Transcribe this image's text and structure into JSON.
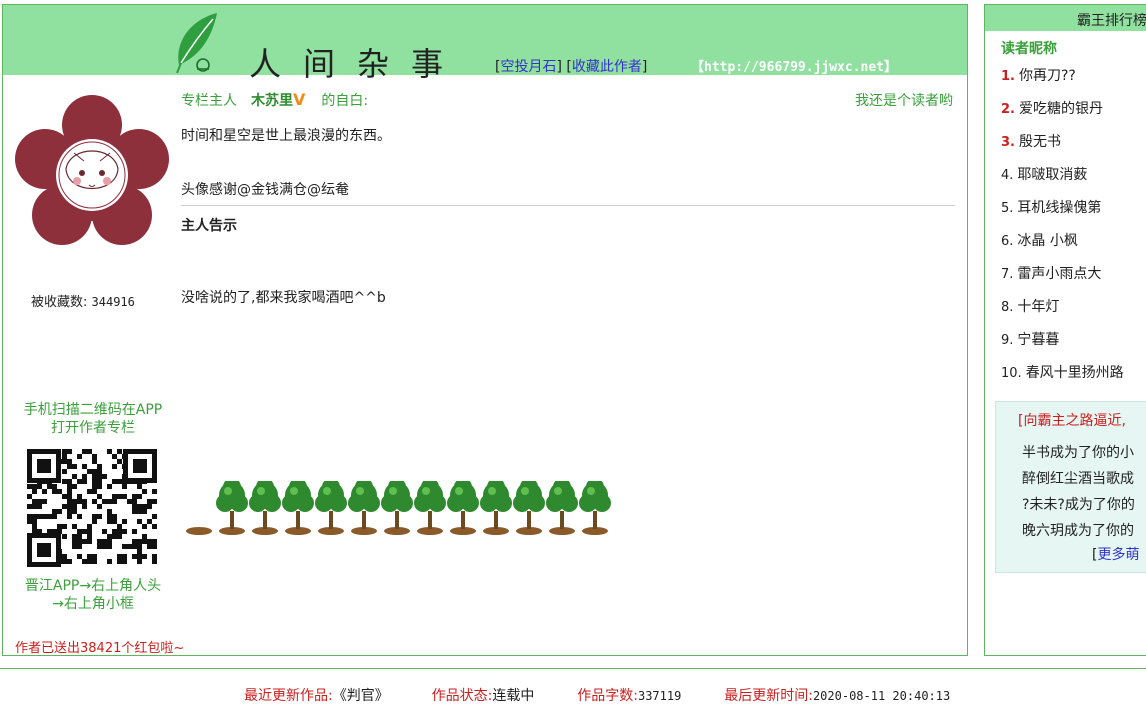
{
  "header": {
    "site_title": "人间杂事",
    "link_bracket_open": "[",
    "link_bracket_mid": "] [",
    "link_bracket_close": "]",
    "link_moonstone": "空投月石",
    "link_favorite": "收藏此作者",
    "url": "【http://966799.jjwxc.net】"
  },
  "profile": {
    "favorites_label": "被收藏数:",
    "favorites_count": "344916",
    "owner_label": "专栏主人",
    "owner_name": "木苏里",
    "v_badge": "V",
    "owner_suffix": "的自白:",
    "reader_link": "我还是个读者哟",
    "bio_line1": "时间和星空是世上最浪漫的东西。",
    "bio_line2": "头像感谢@金钱满仓@纭奙",
    "notice_title": "主人告示",
    "notice_body": "没啥说的了,都来我家喝酒吧^^b"
  },
  "qr": {
    "caption": "手机扫描二维码在APP打开作者专栏",
    "hint": "晋江APP→右上角人头→右上角小框"
  },
  "redpacket": "作者已送出38421个红包啦~",
  "trees": {
    "count": 12,
    "empty_plots": 1
  },
  "sidebar": {
    "title": "霸王排行榜",
    "rank_title": "读者昵称",
    "ranks": [
      {
        "num": "1.",
        "name": "你再刀??"
      },
      {
        "num": "2.",
        "name": "爱吃糖的银丹"
      },
      {
        "num": "3.",
        "name": "殷无书"
      },
      {
        "num": "4.",
        "name": "耶啵取消薮"
      },
      {
        "num": "5.",
        "name": "耳机线操傀第"
      },
      {
        "num": "6.",
        "name": "冰晶 小枫"
      },
      {
        "num": "7.",
        "name": "雷声小雨点大"
      },
      {
        "num": "8.",
        "name": "十年灯"
      },
      {
        "num": "9.",
        "name": "宁暮暮"
      },
      {
        "num": "10.",
        "name": "春风十里扬州路"
      }
    ],
    "box_title": "[向霸主之路逼近,",
    "box_lines": [
      "半书成为了你的小",
      "醉倒红尘酒当歌成",
      "?未未?成为了你的",
      "晚六玥成为了你的"
    ],
    "box_more_open": "[",
    "box_more": "更多萌"
  },
  "footer": {
    "latest_label": "最近更新作品:",
    "latest_value": "《判官》",
    "status_label": "作品状态:",
    "status_value": "连载中",
    "words_label": "作品字数:",
    "words_value": "337119",
    "time_label": "最后更新时间:",
    "time_value": "2020-08-11 20:40:13"
  },
  "colors": {
    "header_green": "#90e0a0",
    "text_green": "#3aa03a",
    "accent_red": "#cc1f1f",
    "link_blue": "#3333cc",
    "avatar_flower": "#8e2f3c"
  }
}
